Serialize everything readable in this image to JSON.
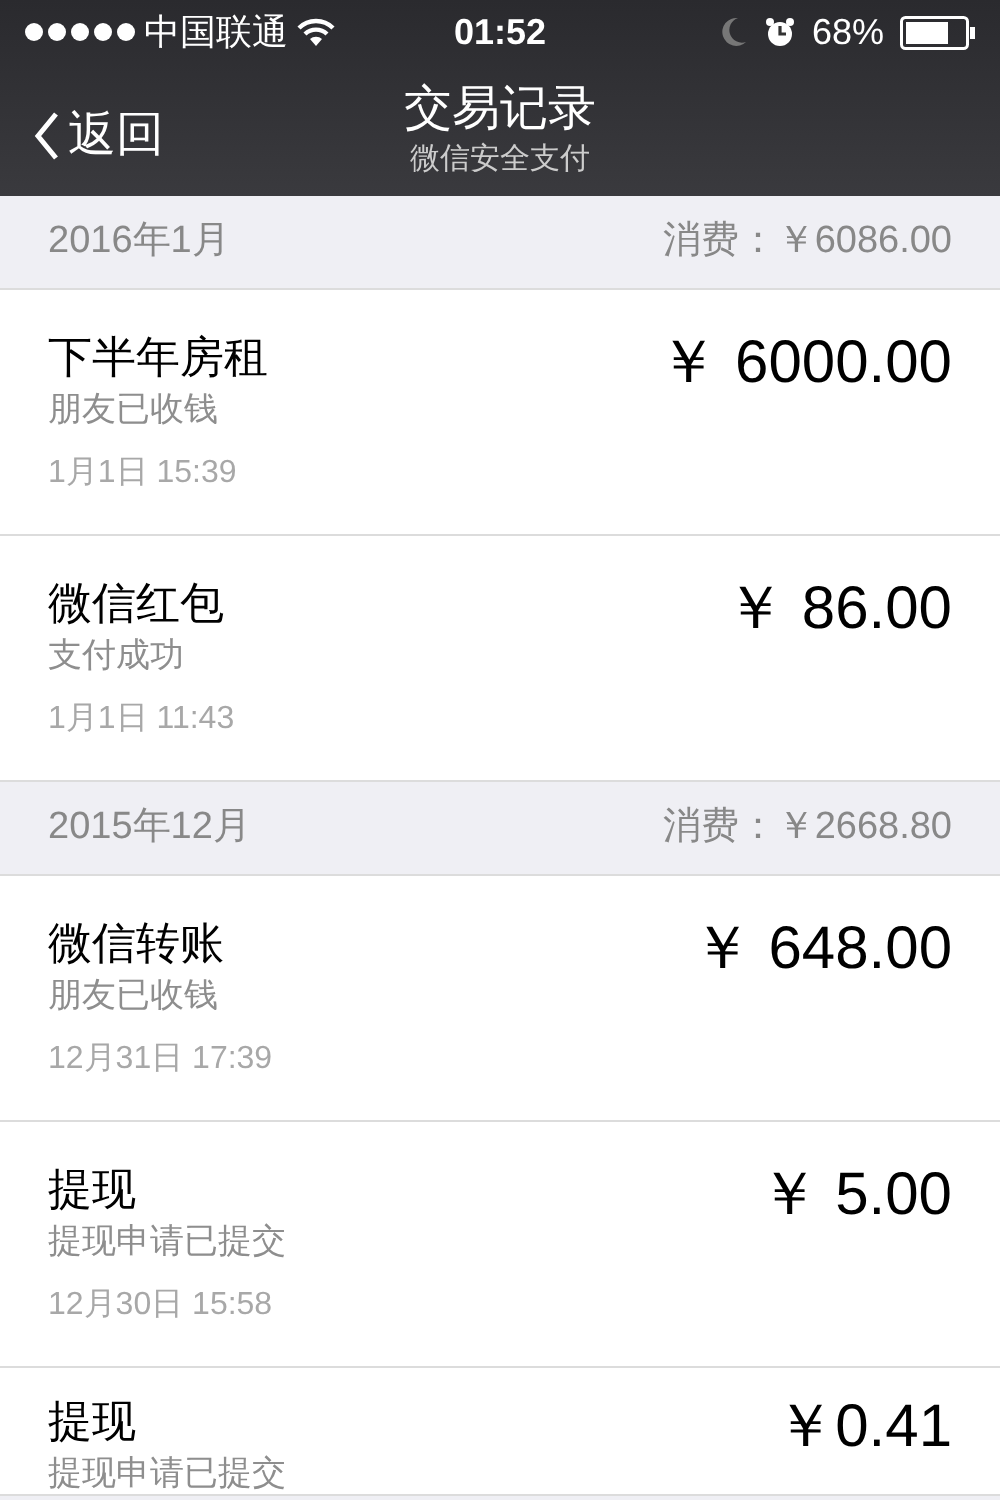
{
  "status_bar": {
    "carrier": "中国联通",
    "time": "01:52",
    "battery": "68%"
  },
  "nav": {
    "back": "返回",
    "title": "交易记录",
    "subtitle": "微信安全支付"
  },
  "sections": [
    {
      "month": "2016年1月",
      "total": "消费：￥6086.00",
      "rows": [
        {
          "title": "下半年房租",
          "status": "朋友已收钱",
          "date": "1月1日 15:39",
          "amount": "￥ 6000.00"
        },
        {
          "title": "微信红包",
          "status": "支付成功",
          "date": "1月1日 11:43",
          "amount": "￥ 86.00"
        }
      ]
    },
    {
      "month": "2015年12月",
      "total": "消费：￥2668.80",
      "rows": [
        {
          "title": "微信转账",
          "status": "朋友已收钱",
          "date": "12月31日 17:39",
          "amount": "￥ 648.00"
        },
        {
          "title": "提现",
          "status": "提现申请已提交",
          "date": "12月30日 15:58",
          "amount": "￥ 5.00"
        },
        {
          "title": "提现",
          "status": "提现申请已提交",
          "amount": "￥0.41"
        }
      ]
    }
  ]
}
